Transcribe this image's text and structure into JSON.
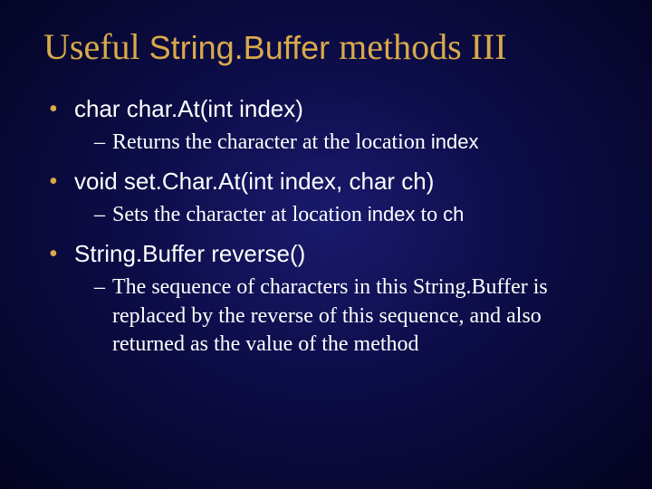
{
  "title": {
    "pre": "Useful ",
    "code": "String.Buffer",
    "post": " methods III"
  },
  "items": [
    {
      "signature": "char char.At(int index)",
      "desc_pre": "Returns the character at the location ",
      "desc_code1": "index",
      "desc_mid": "",
      "desc_code2": "",
      "desc_post": ""
    },
    {
      "signature": "void set.Char.At(int index, char ch)",
      "desc_pre": "Sets the character at location ",
      "desc_code1": "index",
      "desc_mid": " to ",
      "desc_code2": "ch",
      "desc_post": ""
    },
    {
      "signature": "String.Buffer reverse()",
      "desc_pre": "The sequence of characters in this String.Buffer is replaced by the reverse of this sequence, and also returned as the value of the method",
      "desc_code1": "",
      "desc_mid": "",
      "desc_code2": "",
      "desc_post": ""
    }
  ]
}
